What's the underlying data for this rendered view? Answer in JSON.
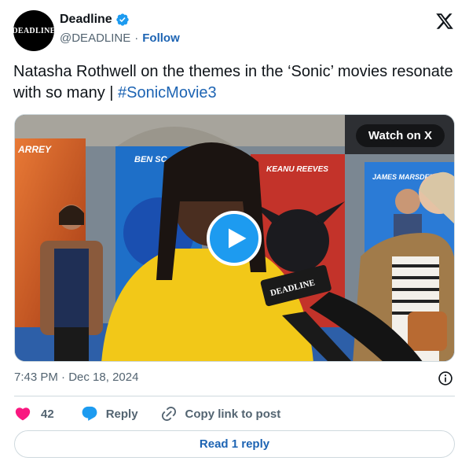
{
  "author": {
    "avatar_text": "DEADLINE",
    "name": "Deadline",
    "handle": "@DEADLINE",
    "separator": "·",
    "follow_label": "Follow"
  },
  "tweet": {
    "text": "Natasha Rothwell on the themes in the ‘Sonic’ movies resonate with so many | ",
    "hashtag": "#SonicMovie3"
  },
  "media": {
    "watch_label": "Watch on X",
    "posters": [
      "ARREY",
      "BEN SC",
      "KEANU REEVES",
      "JAMES MARSDEN"
    ],
    "mic_flag_text": "DEADLINE"
  },
  "meta": {
    "time": "7:43 PM",
    "separator": "·",
    "date": "Dec 18, 2024"
  },
  "actions": {
    "like_count": "42",
    "reply_label": "Reply",
    "copy_label": "Copy link to post"
  },
  "read_replies_label": "Read 1 reply",
  "colors": {
    "accent_blue": "#1d9bf0",
    "link_blue": "#1d64b3",
    "like_red": "#f91880",
    "muted": "#536471",
    "border": "#cfd9de"
  }
}
